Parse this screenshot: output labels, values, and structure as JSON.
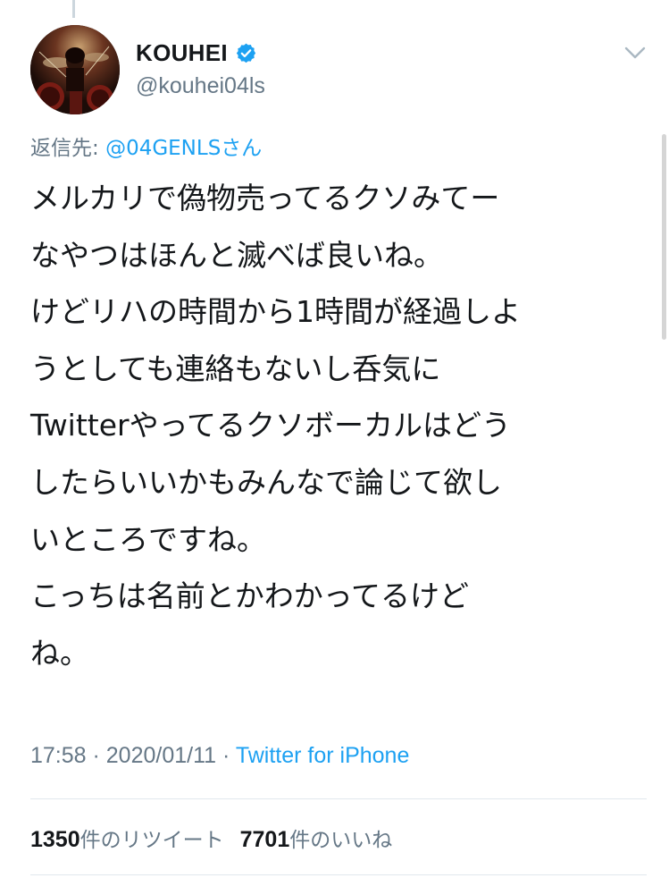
{
  "tweet": {
    "author": {
      "display_name": "KOUHEI",
      "handle": "@kouhei04ls",
      "verified": true,
      "avatar_icon": "drummer-photo-avatar"
    },
    "reply_to": {
      "prefix": "返信先: ",
      "mention": "@04GENLSさん"
    },
    "text_lines": [
      "メルカリで偽物売ってるクソみてー",
      "なやつはほんと滅べば良いね。",
      "けどリハの時間から1時間が経過しよ",
      "うとしても連絡もないし呑気に",
      "Twitterやってるクソボーカルはどう",
      "したらいいかもみんなで論じて欲し",
      "いところですね。",
      "こっちは名前とかわかってるけど",
      "ね。"
    ],
    "meta": {
      "time": "17:58",
      "separator": " · ",
      "date": "2020/01/11",
      "source": "Twitter for iPhone"
    },
    "stats": {
      "retweets_count": "1350",
      "retweets_label": "件のリツイート",
      "likes_count": "7701",
      "likes_label": "件のいいね"
    }
  },
  "colors": {
    "accent": "#1da1f2",
    "secondary_text": "#657786",
    "primary_text": "#14171a",
    "divider": "#e1e8ed"
  }
}
